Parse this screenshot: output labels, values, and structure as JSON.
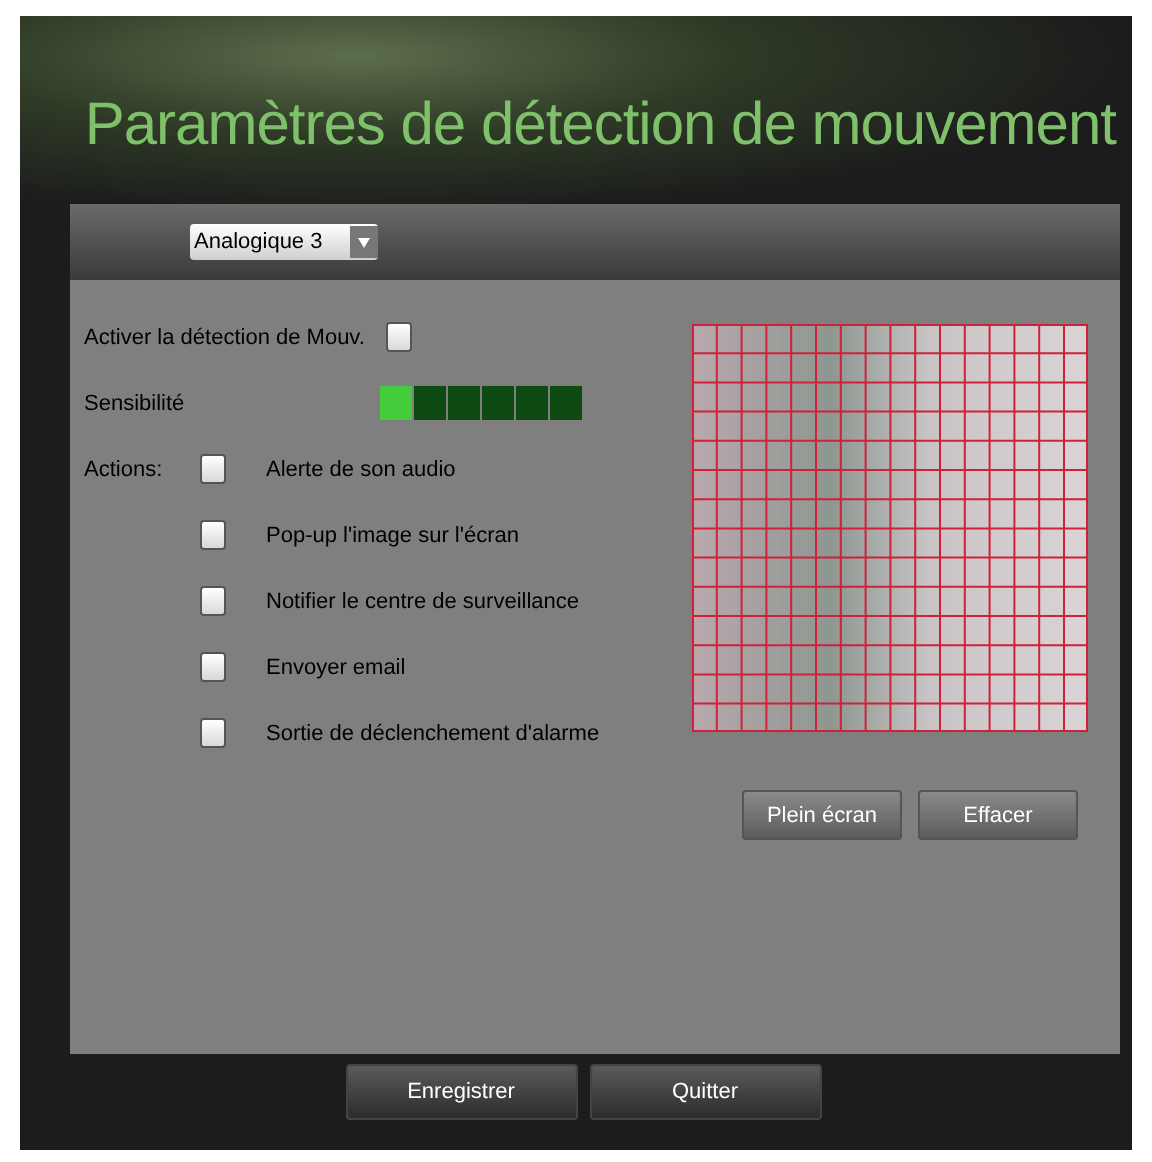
{
  "title": "Paramètres de détection de mouvement",
  "camera_select": {
    "value": "Analogique 3"
  },
  "enable": {
    "label": "Activer la détection de Mouv.",
    "checked": false
  },
  "sensitivity": {
    "label": "Sensibilité",
    "level": 0.17
  },
  "actions": {
    "label": "Actions:",
    "items": [
      {
        "label": "Alerte de son audio",
        "checked": false
      },
      {
        "label": "Pop-up l'image sur l'écran",
        "checked": false
      },
      {
        "label": "Notifier le centre de surveillance",
        "checked": false
      },
      {
        "label": "Envoyer email",
        "checked": false
      },
      {
        "label": "Sortie de déclenchement d'alarme",
        "checked": false
      }
    ]
  },
  "preview_buttons": [
    "Plein écran",
    "Effacer"
  ],
  "footer_buttons": [
    "Enregistrer",
    "Quitter"
  ]
}
